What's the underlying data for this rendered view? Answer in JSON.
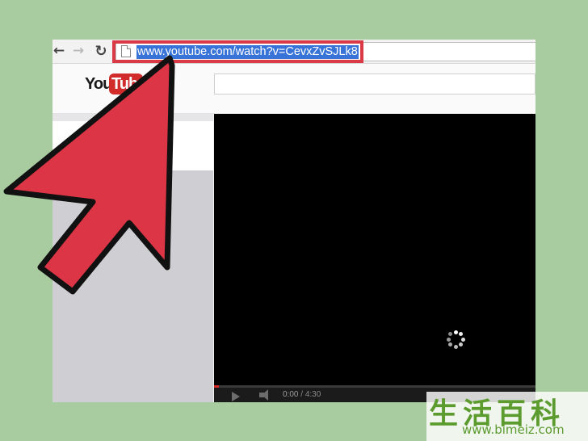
{
  "browser": {
    "back_icon": "arrow-left-icon",
    "forward_icon": "arrow-right-icon",
    "reload_icon": "reload-icon",
    "page_icon": "page-icon",
    "url": "www.youtube.com/watch?v=CevxZvSJLk8"
  },
  "youtube": {
    "logo_you": "You",
    "logo_tube": "Tube",
    "search_value": ""
  },
  "player": {
    "current_time": "0:00",
    "duration": "4:30",
    "progress_fraction": 0.015,
    "state": "loading"
  },
  "annotation": {
    "highlight_color": "#d93a45",
    "arrow_color": "#dc3545"
  },
  "watermark": {
    "chinese": "生活百科",
    "url": "www.bimeiz.com"
  }
}
